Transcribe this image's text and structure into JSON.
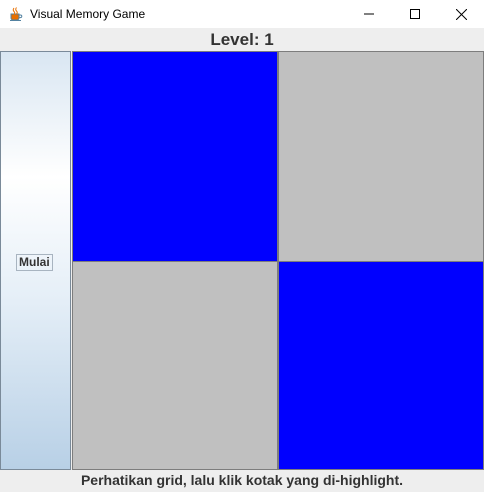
{
  "window": {
    "title": "Visual Memory Game",
    "app_icon": "java-coffee-cup-icon"
  },
  "level": {
    "text": "Level: 1"
  },
  "controls": {
    "start_label": "Mulai"
  },
  "grid": {
    "rows": 2,
    "cols": 2,
    "cells": [
      {
        "state": "highlighted",
        "color": "#0000ff"
      },
      {
        "state": "normal",
        "color": "#c0c0c0"
      },
      {
        "state": "normal",
        "color": "#c0c0c0"
      },
      {
        "state": "highlighted",
        "color": "#0000ff"
      }
    ]
  },
  "status": {
    "message": "Perhatikan grid, lalu klik kotak yang di-highlight."
  },
  "colors": {
    "highlight": "#0000ff",
    "cell_default": "#c0c0c0",
    "background": "#eeeeee"
  }
}
